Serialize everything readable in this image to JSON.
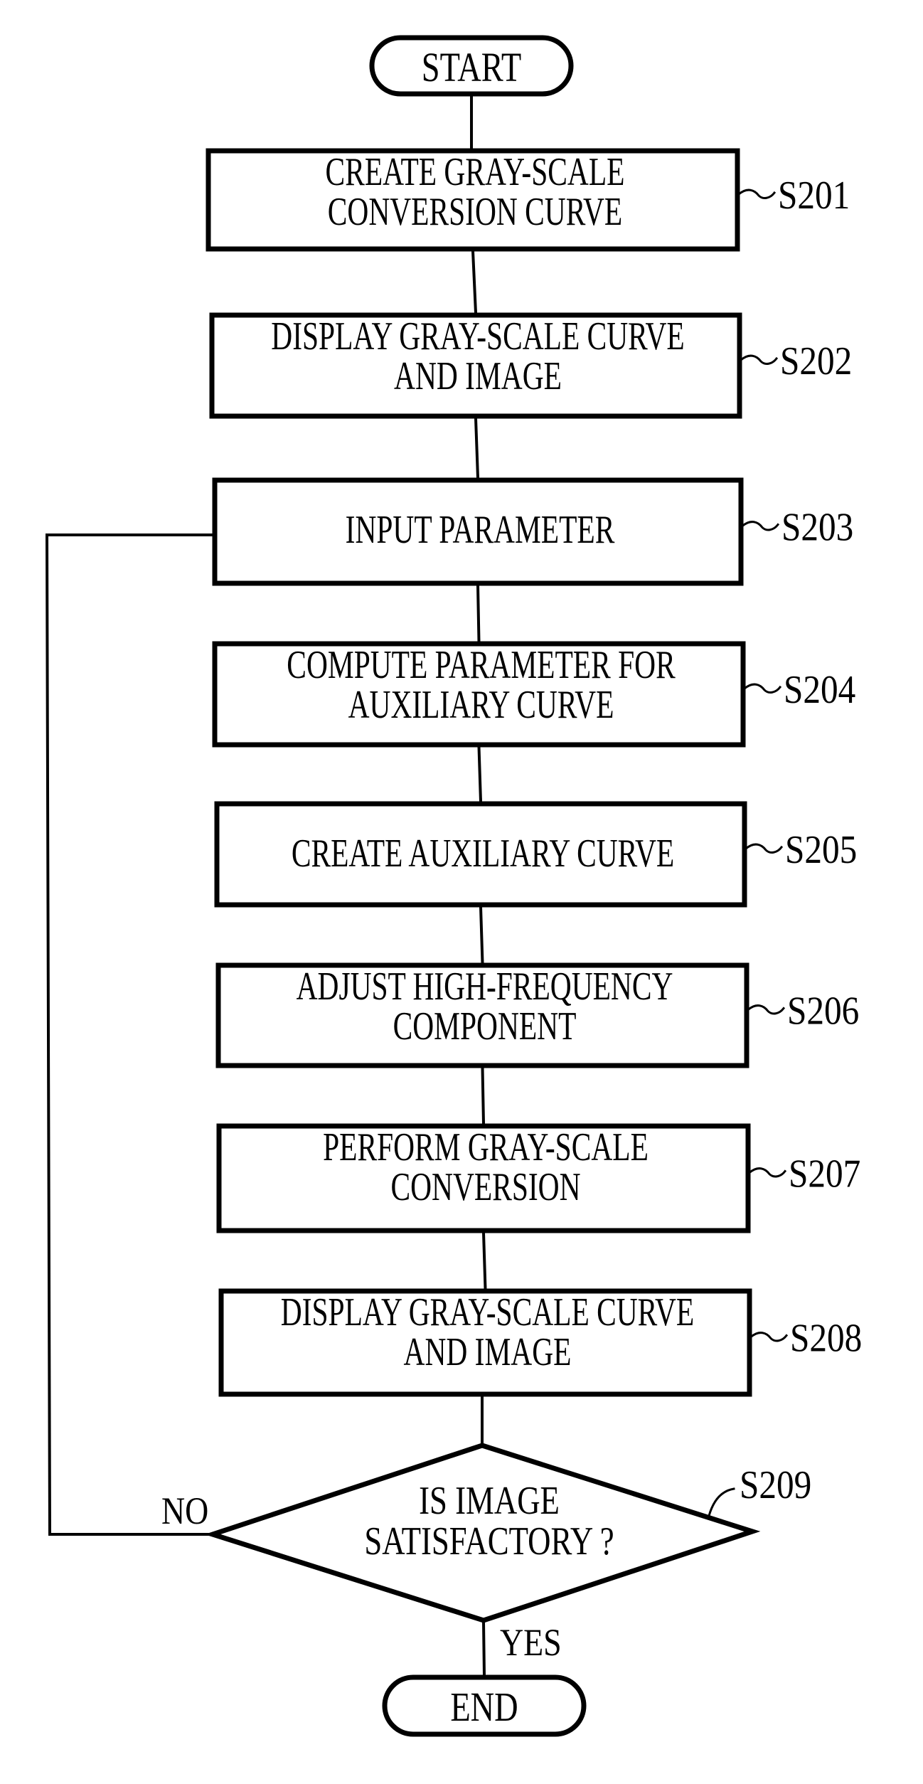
{
  "diagram": {
    "type": "flowchart",
    "colors": {
      "ink": "#000000",
      "background": "#ffffff"
    },
    "start": {
      "id": "start",
      "label": "START"
    },
    "end": {
      "id": "end",
      "label": "END"
    },
    "steps": [
      {
        "id": "S201",
        "ref": "S201",
        "lines": [
          "CREATE GRAY-SCALE",
          "CONVERSION CURVE"
        ]
      },
      {
        "id": "S202",
        "ref": "S202",
        "lines": [
          "DISPLAY GRAY-SCALE CURVE",
          "AND IMAGE"
        ]
      },
      {
        "id": "S203",
        "ref": "S203",
        "lines": [
          "INPUT PARAMETER"
        ]
      },
      {
        "id": "S204",
        "ref": "S204",
        "lines": [
          "COMPUTE PARAMETER FOR",
          "AUXILIARY CURVE"
        ]
      },
      {
        "id": "S205",
        "ref": "S205",
        "lines": [
          "CREATE AUXILIARY CURVE"
        ]
      },
      {
        "id": "S206",
        "ref": "S206",
        "lines": [
          "ADJUST HIGH-FREQUENCY",
          "COMPONENT"
        ]
      },
      {
        "id": "S207",
        "ref": "S207",
        "lines": [
          "PERFORM GRAY-SCALE",
          "CONVERSION"
        ]
      },
      {
        "id": "S208",
        "ref": "S208",
        "lines": [
          "DISPLAY GRAY-SCALE CURVE",
          "AND IMAGE"
        ]
      }
    ],
    "decision": {
      "id": "S209",
      "ref": "S209",
      "lines": [
        "IS IMAGE",
        "SATISFACTORY ?"
      ],
      "yes_label": "YES",
      "no_label": "NO",
      "yes_target": "end",
      "no_target": "S203"
    },
    "edges": [
      {
        "from": "start",
        "to": "S201"
      },
      {
        "from": "S201",
        "to": "S202"
      },
      {
        "from": "S202",
        "to": "S203"
      },
      {
        "from": "S203",
        "to": "S204"
      },
      {
        "from": "S204",
        "to": "S205"
      },
      {
        "from": "S205",
        "to": "S206"
      },
      {
        "from": "S206",
        "to": "S207"
      },
      {
        "from": "S207",
        "to": "S208"
      },
      {
        "from": "S208",
        "to": "S209"
      },
      {
        "from": "S209",
        "to": "end",
        "label": "YES"
      },
      {
        "from": "S209",
        "to": "S203",
        "label": "NO"
      }
    ]
  }
}
